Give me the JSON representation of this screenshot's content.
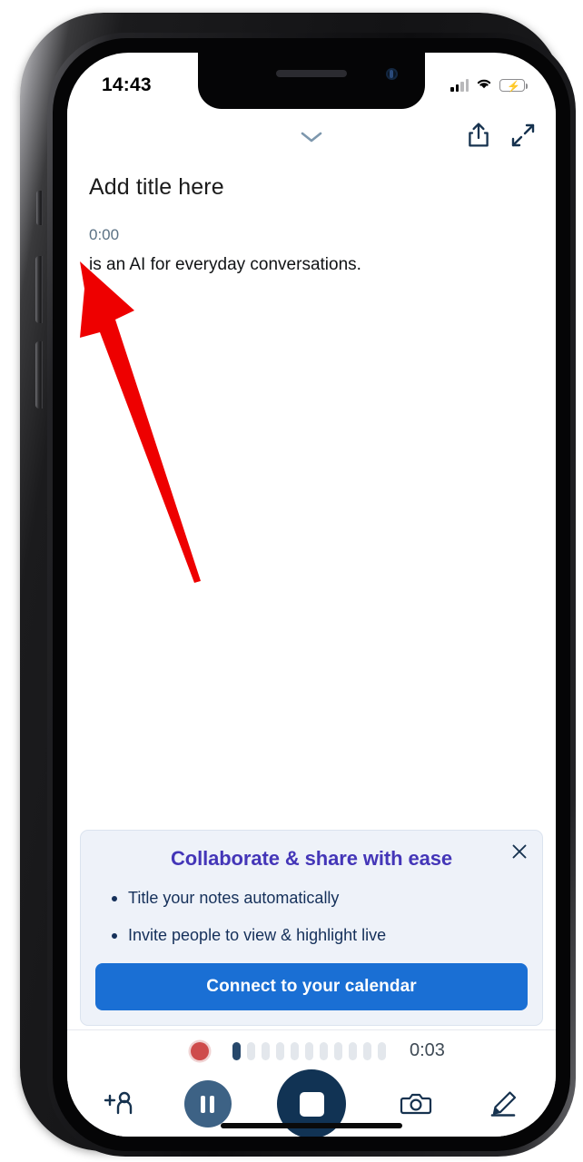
{
  "device": {
    "status_bar": {
      "time": "14:43",
      "signal_icon": "cellular-signal-icon",
      "wifi_icon": "wifi-icon",
      "battery_icon": "battery-charging-icon",
      "battery_charging": true
    },
    "home_indicator": "home-indicator"
  },
  "app": {
    "topbar": {
      "collapse_icon": "chevron-down-icon",
      "share_icon": "share-icon",
      "expand_icon": "expand-arrows-icon"
    },
    "note": {
      "title_placeholder": "Add title here",
      "timestamp": "0:00",
      "transcript": "is an AI for everyday conversations."
    },
    "promo_card": {
      "close_icon": "close-icon",
      "title": "Collaborate & share with ease",
      "bullets": [
        "Title your notes automatically",
        "Invite people to view & highlight live"
      ],
      "cta_label": "Connect to your calendar"
    },
    "recording": {
      "record_dot": "recording-indicator",
      "elapsed": "0:03",
      "waveform_bars": [
        1,
        0,
        0,
        0,
        0,
        0,
        0,
        0,
        0,
        0,
        0
      ]
    },
    "toolbar": {
      "add_person_icon": "add-person-icon",
      "pause_icon": "pause-icon",
      "stop_icon": "stop-icon",
      "camera_icon": "camera-icon",
      "highlighter_icon": "highlighter-pen-icon"
    }
  },
  "annotation": {
    "arrow": "red-arrow-pointing-to-transcript"
  },
  "colors": {
    "accent_blue": "#1a6fd4",
    "navy": "#113354",
    "pause_blue": "#3d6285",
    "promo_purple": "#4436b8",
    "promo_bg": "#eef2f9",
    "record_red": "#ce4b4b",
    "annotation_red": "#ee0000",
    "timestamp_gray": "#5a7184"
  }
}
